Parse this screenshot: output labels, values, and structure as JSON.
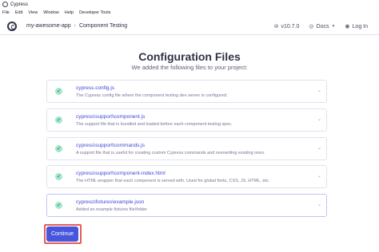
{
  "window": {
    "title": "Cypress"
  },
  "menu": [
    "File",
    "Edit",
    "View",
    "Window",
    "Help",
    "Developer Tools"
  ],
  "header": {
    "project": "my-awesome-app",
    "section": "Component Testing",
    "version": "v10.7.0",
    "docs": "Docs",
    "login": "Log In"
  },
  "main": {
    "title": "Configuration Files",
    "subtitle": "We added the following files to your project:",
    "files": [
      {
        "name": "cypress.config.js",
        "desc": "The Cypress config file where the component testing dev server is configured."
      },
      {
        "name": "cypress\\support\\component.js",
        "desc": "The support file that is bundled and loaded before each component testing spec."
      },
      {
        "name": "cypress\\support\\commands.js",
        "desc": "A support file that is useful for creating custom Cypress commands and overwriting existing ones."
      },
      {
        "name": "cypress\\support\\component-index.html",
        "desc": "The HTML wrapper that each component is served with. Used for global fonts, CSS, JS, HTML, etc."
      },
      {
        "name": "cypress\\fixtures\\example.json",
        "desc": "Added an example fixtures file/folder"
      }
    ],
    "continue_label": "Continue"
  },
  "colors": {
    "accent": "#4756dd",
    "highlight": "#e65c5c",
    "success": "#a3e7cb"
  }
}
